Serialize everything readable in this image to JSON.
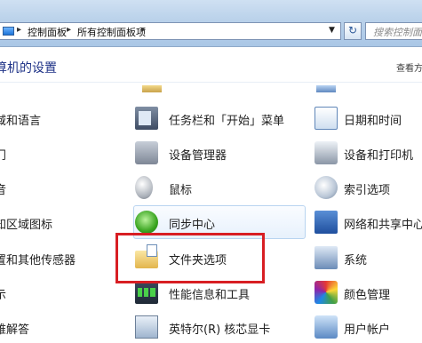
{
  "address_bar": {
    "breadcrumbs": [
      "控制面板",
      "所有控制面板项"
    ],
    "search_placeholder": "搜索控制面板",
    "refresh_icon": "refresh-icon",
    "dropdown_icon": "chevron-down-icon"
  },
  "header": {
    "title": "算机的设置",
    "view_by": "查看方"
  },
  "items": {
    "col0": [
      "域和语言",
      "门",
      "音",
      "知区域图标",
      "置和其他传感器",
      "示",
      "难解答"
    ],
    "col1": [
      "任务栏和「开始」菜单",
      "设备管理器",
      "鼠标",
      "同步中心",
      "文件夹选项",
      "性能信息和工具",
      "英特尔(R) 核芯显卡"
    ],
    "col2": [
      "日期和时间",
      "设备和打印机",
      "索引选项",
      "网络和共享中心",
      "系统",
      "颜色管理",
      "用户帐户"
    ]
  },
  "colors": {
    "annotation_red": "#d81e23",
    "title_blue": "#1e3287",
    "hover_blue": "#b8d4f0"
  }
}
